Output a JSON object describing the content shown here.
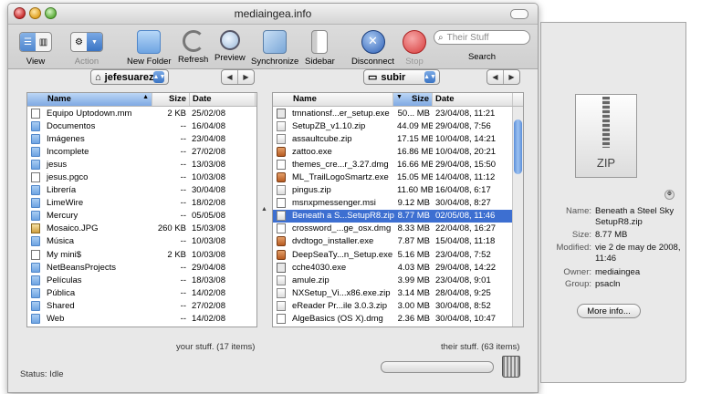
{
  "window": {
    "title": "mediaingea.info"
  },
  "toolbar": {
    "view_label": "View",
    "action_label": "Action",
    "new_folder_label": "New Folder",
    "refresh_label": "Refresh",
    "preview_label": "Preview",
    "synchronize_label": "Synchronize",
    "sidebar_label": "Sidebar",
    "disconnect_label": "Disconnect",
    "stop_label": "Stop",
    "search_placeholder": "Their Stuff",
    "search_label": "Search"
  },
  "left": {
    "path": "jefesuarez",
    "columns": {
      "name": "Name",
      "size": "Size",
      "date": "Date"
    },
    "files": [
      {
        "name": "Equipo Uptodown.mm",
        "size": "2 KB",
        "date": "25/02/08",
        "icon": "doc"
      },
      {
        "name": "Documentos",
        "size": "--",
        "date": "16/04/08",
        "icon": "folder"
      },
      {
        "name": "Imágenes",
        "size": "--",
        "date": "23/04/08",
        "icon": "folder"
      },
      {
        "name": "Incomplete",
        "size": "--",
        "date": "27/02/08",
        "icon": "folder"
      },
      {
        "name": "jesus",
        "size": "--",
        "date": "13/03/08",
        "icon": "folder"
      },
      {
        "name": "jesus.pgco",
        "size": "--",
        "date": "10/03/08",
        "icon": "doc"
      },
      {
        "name": "Librería",
        "size": "--",
        "date": "30/04/08",
        "icon": "folder"
      },
      {
        "name": "LimeWire",
        "size": "--",
        "date": "18/02/08",
        "icon": "folder"
      },
      {
        "name": "Mercury",
        "size": "--",
        "date": "05/05/08",
        "icon": "folder"
      },
      {
        "name": "Mosaico.JPG",
        "size": "260 KB",
        "date": "15/03/08",
        "icon": "img"
      },
      {
        "name": "Música",
        "size": "--",
        "date": "10/03/08",
        "icon": "folder"
      },
      {
        "name": "My mini$",
        "size": "2 KB",
        "date": "10/03/08",
        "icon": "doc"
      },
      {
        "name": "NetBeansProjects",
        "size": "--",
        "date": "29/04/08",
        "icon": "folder"
      },
      {
        "name": "Películas",
        "size": "--",
        "date": "18/03/08",
        "icon": "folder"
      },
      {
        "name": "Pública",
        "size": "--",
        "date": "14/02/08",
        "icon": "folder"
      },
      {
        "name": "Shared",
        "size": "--",
        "date": "27/02/08",
        "icon": "folder"
      },
      {
        "name": "Web",
        "size": "--",
        "date": "14/02/08",
        "icon": "folder"
      }
    ],
    "footer": "your stuff. (17 items)"
  },
  "right": {
    "path": "subir",
    "columns": {
      "name": "Name",
      "size": "Size",
      "date": "Date"
    },
    "files": [
      {
        "name": "tmnationsf...er_setup.exe",
        "size": "50... MB",
        "date": "23/04/08, 11:21",
        "icon": "exe"
      },
      {
        "name": "SetupZB_v1.10.zip",
        "size": "44.09 MB",
        "date": "29/04/08, 7:56",
        "icon": "zip"
      },
      {
        "name": "assaultcube.zip",
        "size": "17.15 MB",
        "date": "10/04/08, 14:21",
        "icon": "zip"
      },
      {
        "name": "zattoo.exe",
        "size": "16.86 MB",
        "date": "10/04/08, 20:21",
        "icon": "app"
      },
      {
        "name": "themes_cre...r_3.27.dmg",
        "size": "16.66 MB",
        "date": "29/04/08, 15:50",
        "icon": "doc"
      },
      {
        "name": "ML_TrailLogoSmartz.exe",
        "size": "15.05 MB",
        "date": "14/04/08, 11:12",
        "icon": "app"
      },
      {
        "name": "pingus.zip",
        "size": "11.60 MB",
        "date": "16/04/08, 6:17",
        "icon": "zip"
      },
      {
        "name": "msnxpmessenger.msi",
        "size": "9.12 MB",
        "date": "30/04/08, 8:27",
        "icon": "doc"
      },
      {
        "name": "Beneath a S...SetupR8.zip",
        "size": "8.77 MB",
        "date": "02/05/08, 11:46",
        "icon": "zip",
        "selected": true
      },
      {
        "name": "crossword_...ge_osx.dmg",
        "size": "8.33 MB",
        "date": "22/04/08, 16:27",
        "icon": "doc"
      },
      {
        "name": "dvdtogo_installer.exe",
        "size": "7.87 MB",
        "date": "15/04/08, 11:18",
        "icon": "app"
      },
      {
        "name": "DeepSeaTy...n_Setup.exe",
        "size": "5.16 MB",
        "date": "23/04/08, 7:52",
        "icon": "app"
      },
      {
        "name": "cche4030.exe",
        "size": "4.03 MB",
        "date": "29/04/08, 14:22",
        "icon": "exe"
      },
      {
        "name": "amule.zip",
        "size": "3.99 MB",
        "date": "23/04/08, 9:01",
        "icon": "zip"
      },
      {
        "name": "NXSetup_Vi...x86.exe.zip",
        "size": "3.14 MB",
        "date": "28/04/08, 9:25",
        "icon": "zip"
      },
      {
        "name": "eReader Pr...ile 3.0.3.zip",
        "size": "3.00 MB",
        "date": "30/04/08, 8:52",
        "icon": "zip"
      },
      {
        "name": "AlgeBasics (OS X).dmg",
        "size": "2.36 MB",
        "date": "30/04/08, 10:47",
        "icon": "doc"
      }
    ],
    "footer": "their stuff. (63 items)"
  },
  "status": "Status: Idle",
  "info": {
    "icon_label": "ZIP",
    "name_key": "Name:",
    "name_value": "Beneath a Steel Sky SetupR8.zip",
    "size_key": "Size:",
    "size_value": "8.77 MB",
    "modified_key": "Modified:",
    "modified_value": "vie 2 de may de 2008, 11:46",
    "owner_key": "Owner:",
    "owner_value": "mediaingea",
    "group_key": "Group:",
    "group_value": "psacln",
    "more_info_label": "More info..."
  },
  "colors": {
    "selection": "#3d6fd1",
    "accent": "#4f86cf"
  }
}
